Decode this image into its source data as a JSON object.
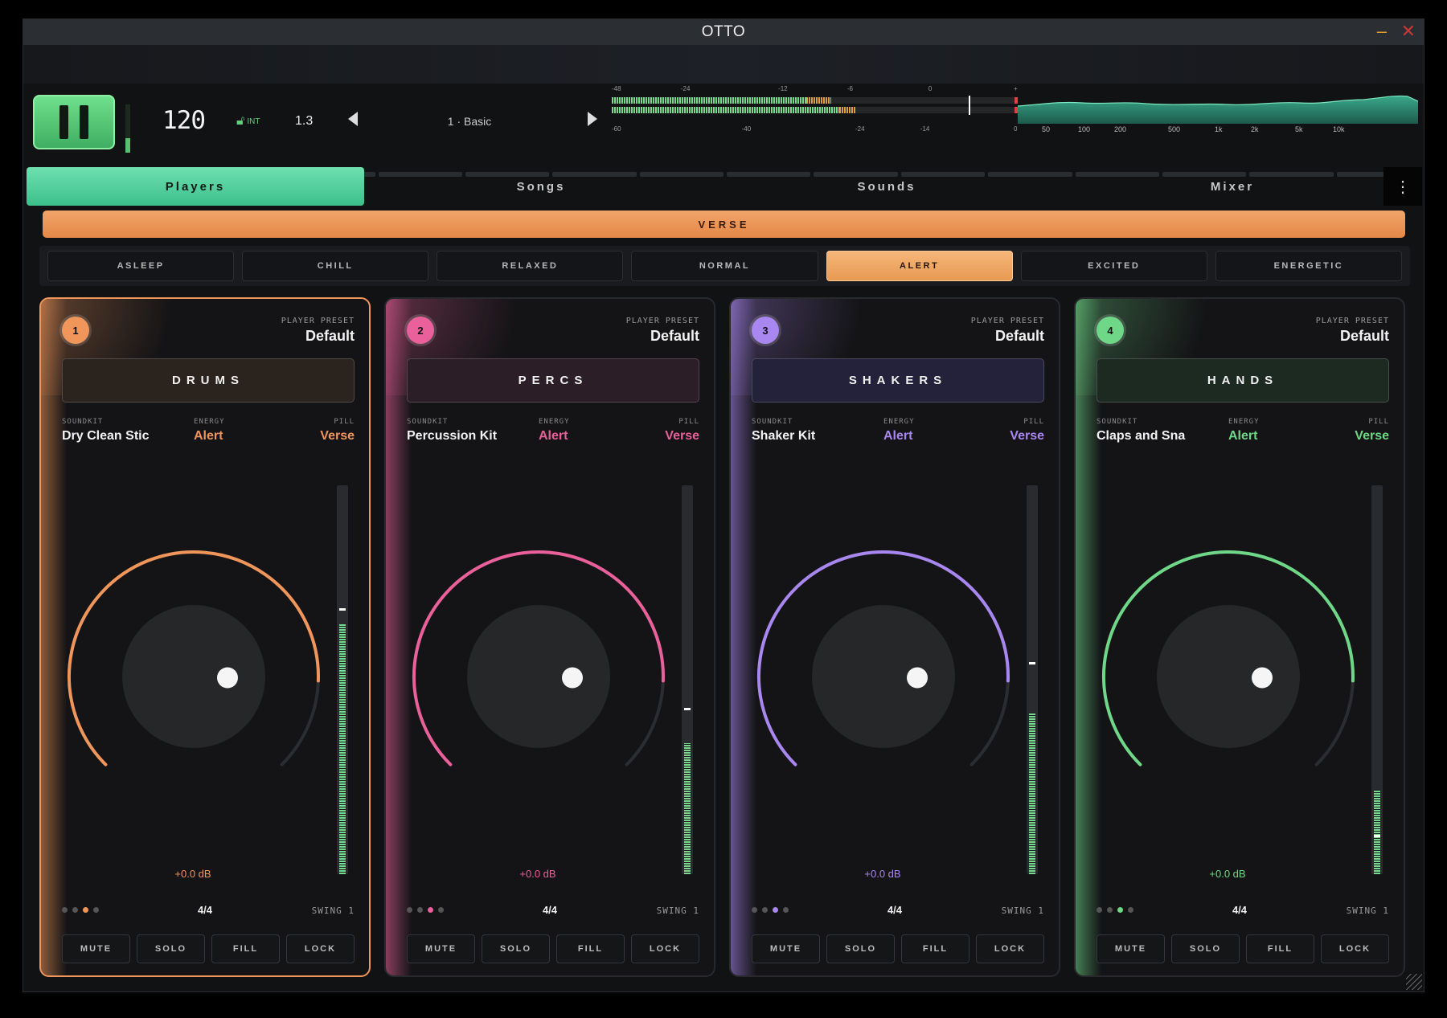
{
  "app": {
    "title": "OTTO"
  },
  "transport": {
    "tempo": "120",
    "lock_label": "INT",
    "bar_position": "1.3",
    "pattern": "1 · Basic",
    "meter_scale_top": [
      "-48",
      "-24",
      "-12",
      "-6",
      "0",
      "+"
    ],
    "meter_scale_bottom": [
      "-60",
      "-40",
      "-24",
      "-14",
      "0"
    ],
    "spectrum_freqs": [
      "50",
      "100",
      "200",
      "500",
      "1k",
      "2k",
      "5k",
      "10k"
    ],
    "progress_segments": 16,
    "progress_done": 2,
    "progress_current": 3
  },
  "tabs": [
    {
      "label": "Players",
      "active": true
    },
    {
      "label": "Songs",
      "active": false
    },
    {
      "label": "Sounds",
      "active": false
    },
    {
      "label": "Mixer",
      "active": false
    }
  ],
  "section": {
    "label": "VERSE"
  },
  "energy_levels": [
    {
      "label": "ASLEEP",
      "active": false
    },
    {
      "label": "CHILL",
      "active": false
    },
    {
      "label": "RELAXED",
      "active": false
    },
    {
      "label": "NORMAL",
      "active": false
    },
    {
      "label": "ALERT",
      "active": true
    },
    {
      "label": "EXCITED",
      "active": false
    },
    {
      "label": "ENERGETIC",
      "active": false
    }
  ],
  "labels": {
    "player_preset": "PLAYER PRESET",
    "soundkit": "SOUNDKIT",
    "energy": "ENERGY",
    "pill": "PILL",
    "mute": "MUTE",
    "solo": "SOLO",
    "fill": "FILL",
    "lock": "LOCK"
  },
  "players": [
    {
      "number": "1",
      "name": "DRUMS",
      "preset": "Default",
      "soundkit": "Dry Clean Stic",
      "energy": "Alert",
      "pill": "Verse",
      "gain": "+0.0 dB",
      "time_signature": "4/4",
      "swing": "SWING 1",
      "active_dot": 2,
      "selected": true,
      "accent": "#f0965a",
      "name_bg": "#2b231e",
      "meter_level": 0.65,
      "meter_peak": 0.68
    },
    {
      "number": "2",
      "name": "PERCS",
      "preset": "Default",
      "soundkit": "Percussion Kit",
      "energy": "Alert",
      "pill": "Verse",
      "gain": "+0.0 dB",
      "time_signature": "4/4",
      "swing": "SWING 1",
      "active_dot": 2,
      "selected": false,
      "accent": "#e9609a",
      "name_bg": "#2c1e26",
      "meter_level": 0.34,
      "meter_peak": 0.42
    },
    {
      "number": "3",
      "name": "SHAKERS",
      "preset": "Default",
      "soundkit": "Shaker Kit",
      "energy": "Alert",
      "pill": "Verse",
      "gain": "+0.0 dB",
      "time_signature": "4/4",
      "swing": "SWING 1",
      "active_dot": 2,
      "selected": false,
      "accent": "#a987f0",
      "name_bg": "#24223a",
      "meter_level": 0.42,
      "meter_peak": 0.54
    },
    {
      "number": "4",
      "name": "HANDS",
      "preset": "Default",
      "soundkit": "Claps and Sna",
      "energy": "Alert",
      "pill": "Verse",
      "gain": "+0.0 dB",
      "time_signature": "4/4",
      "swing": "SWING 1",
      "active_dot": 2,
      "selected": false,
      "accent": "#6fd888",
      "name_bg": "#1c2a22",
      "meter_level": 0.22,
      "meter_peak": 0.09
    }
  ]
}
